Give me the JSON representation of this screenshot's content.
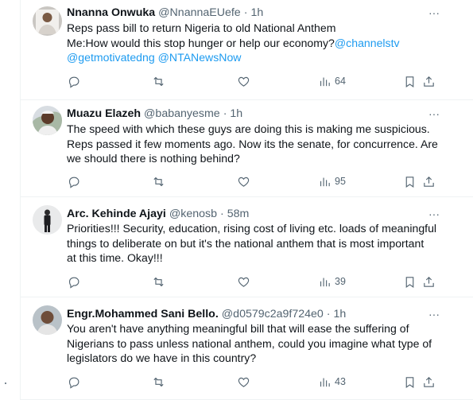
{
  "tweets": [
    {
      "name": "Nnanna Onwuka",
      "handle": "@NnannaEUefe",
      "time": "1h",
      "lines": [
        [
          {
            "text": "Reps pass bill to return Nigeria to old National Anthem"
          }
        ],
        [
          {
            "text": "Me:How would this stop hunger or help our economy?"
          },
          {
            "text": "@channelstv",
            "mention": true
          }
        ],
        [
          {
            "text": "@getmotivatedng @NTANewsNow",
            "mention": true
          }
        ]
      ],
      "views": "64"
    },
    {
      "name": "Muazu Elazeh",
      "handle": "@babanyesme",
      "time": "1h",
      "lines": [
        [
          {
            "text": "The speed with which these guys are doing this is making me suspicious."
          }
        ],
        [
          {
            "text": "Reps passed it few moments ago. Now its the senate, for concurrence. Are"
          }
        ],
        [
          {
            "text": "we should there is nothing behind?"
          }
        ]
      ],
      "views": "95"
    },
    {
      "name": "Arc. Kehinde Ajayi",
      "handle": "@kenosb",
      "time": "58m",
      "lines": [
        [
          {
            "text": "Priorities!!! Security, education, rising cost of living etc. loads of meaningful"
          }
        ],
        [
          {
            "text": "things to deliberate on but it's the national anthem that is most important"
          }
        ],
        [
          {
            "text": "at this time. Okay!!!"
          }
        ]
      ],
      "views": "39"
    },
    {
      "name": "Engr.Mohammed Sani Bello.",
      "handle": "@d0579c2a9f724e0",
      "time": "1h",
      "lines": [
        [
          {
            "text": "You aren't have anything meaningful bill that will ease the suffering of"
          }
        ],
        [
          {
            "text": "Nigerians to pass unless national anthem, could you imagine  what type of"
          }
        ],
        [
          {
            "text": "legislators do we have in this country?"
          }
        ]
      ],
      "views": "43"
    }
  ],
  "colors": {
    "text": "#0f1419",
    "secondary": "#536471",
    "link": "#1d9bf0",
    "divider": "#eff3f4"
  },
  "icons": [
    "reply-icon",
    "repost-icon",
    "like-icon",
    "views-icon",
    "bookmark-icon",
    "share-icon",
    "more-icon"
  ]
}
